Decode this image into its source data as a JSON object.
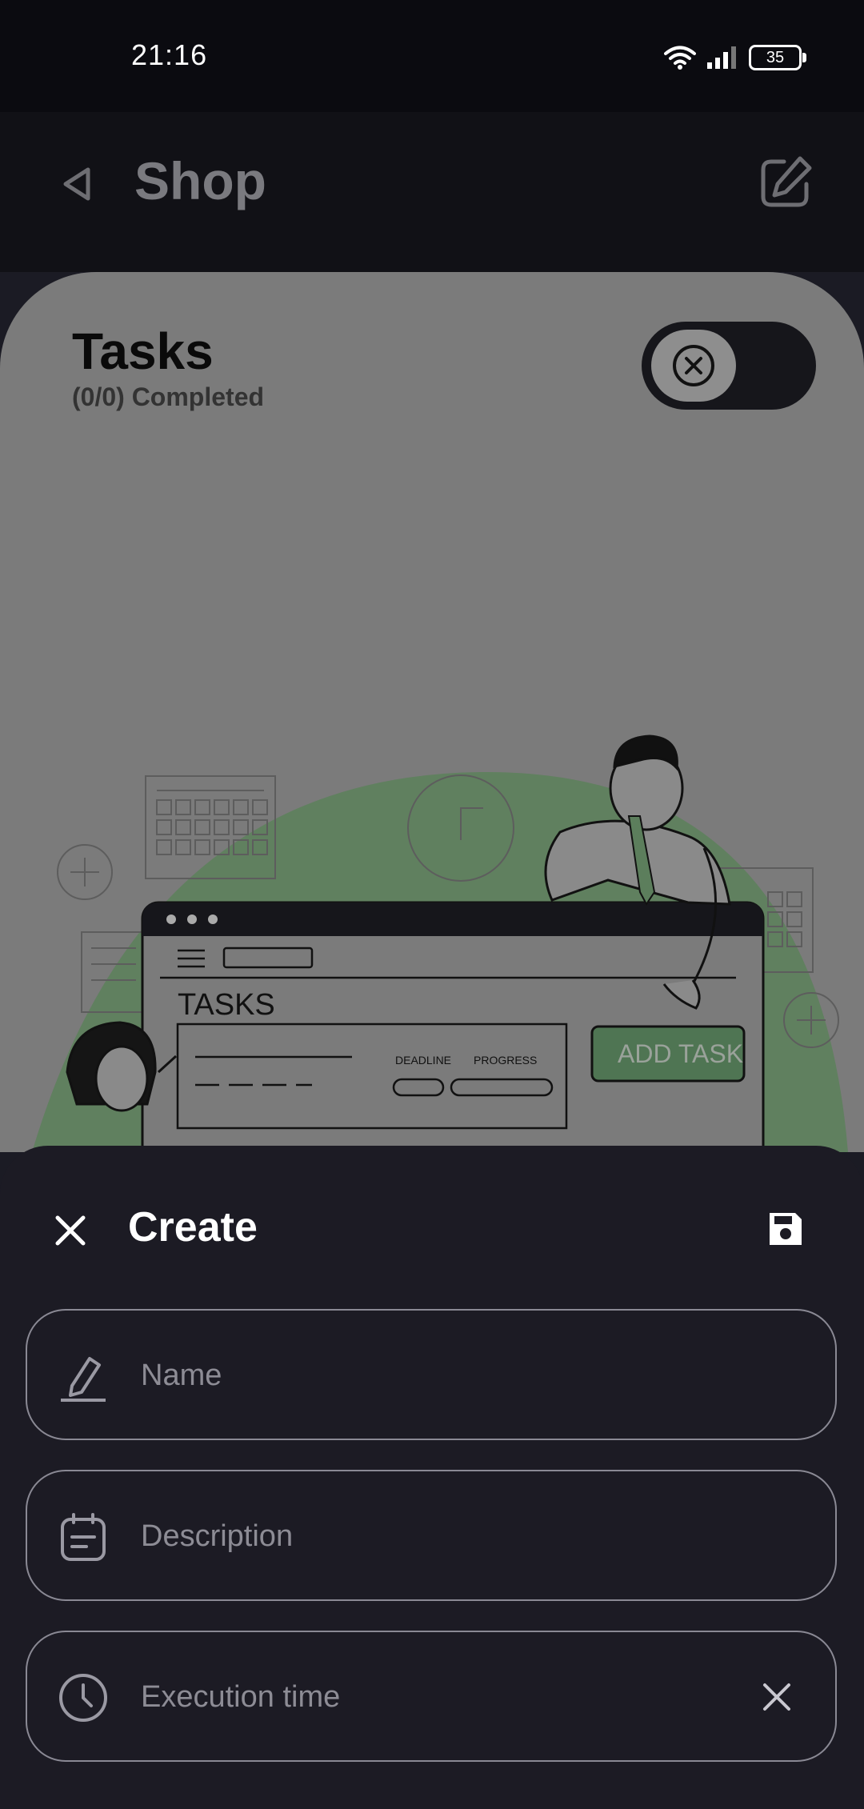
{
  "status_bar": {
    "time": "21:16",
    "battery": "35"
  },
  "appbar": {
    "title": "Shop",
    "back_icon": "back-triangle-icon",
    "edit_icon": "edit-square-icon"
  },
  "tasks_card": {
    "title": "Tasks",
    "subtitle": "(0/0) Completed",
    "toggle_state": "off",
    "illustration": {
      "screen_title": "TASKS",
      "col_deadline": "DEADLINE",
      "col_progress": "PROGRESS",
      "add_button": "ADD TASK"
    }
  },
  "create_sheet": {
    "title": "Create",
    "close_icon": "close-icon",
    "save_icon": "save-icon",
    "fields": [
      {
        "placeholder": "Name",
        "value": "",
        "icon": "pencil-icon"
      },
      {
        "placeholder": "Description",
        "value": "",
        "icon": "notes-icon"
      },
      {
        "placeholder": "Execution time",
        "value": "",
        "icon": "clock-icon",
        "clear_icon": "clear-icon"
      }
    ]
  },
  "colors": {
    "accent_green": "#76b98a",
    "sheet_bg": "#1c1b24",
    "card_bg": "#7b7b7b"
  }
}
